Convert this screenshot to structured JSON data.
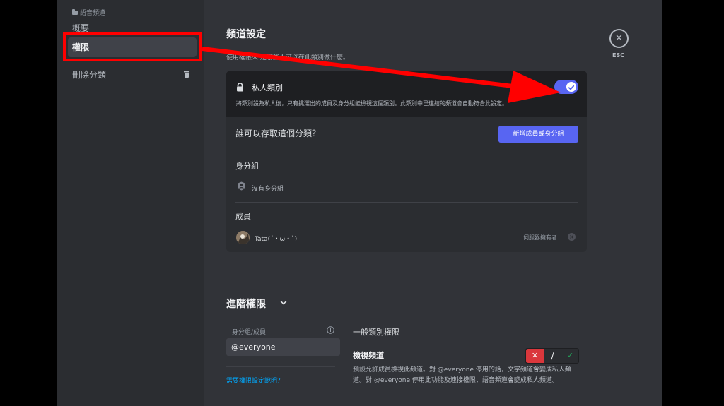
{
  "sidebar": {
    "category": "語音頻道",
    "items": [
      {
        "label": "概要"
      },
      {
        "label": "權限"
      },
      {
        "label": "刪除分類"
      }
    ]
  },
  "header": {
    "title": "頻道設定",
    "subtitle": "使用權限來 定哪些人可以在此類別做什麼。"
  },
  "private": {
    "label": "私人類別",
    "description": "將類別設為私人後，只有挑選出的成員及身分組能檢視這個類別。此類別中已連結的頻道會自動符合此設定。",
    "enabled": true
  },
  "access": {
    "question": "誰可以存取這個分類？",
    "add_button": "新增成員或身分組",
    "roles_heading": "身分組",
    "no_roles": "沒有身分組",
    "members_heading": "成員",
    "members": [
      {
        "name": "Tata(´・ω・`)",
        "tag": "伺服器擁有者"
      }
    ]
  },
  "advanced": {
    "title": "進階權限",
    "list_heading": "身分組/成員",
    "selected": "@everyone",
    "help_link": "需要權限設定說明？",
    "section": "一般類別權限",
    "permission": {
      "name": "檢視頻道",
      "description": "預設允許成員檢視此頻道。對 @everyone 停用的話，文字頻道會變成私人頻道。對 @everyone 停用此功能及連接權限，語音頻道會變成私人頻道。",
      "deny": "✕",
      "neutral": "/",
      "allow": "✓"
    }
  },
  "close": {
    "icon": "close-icon",
    "label": "ESC"
  },
  "colors": {
    "accent": "#5865f2",
    "annotation": "#ff0000",
    "deny": "#da373c",
    "allow": "#23a55a"
  }
}
